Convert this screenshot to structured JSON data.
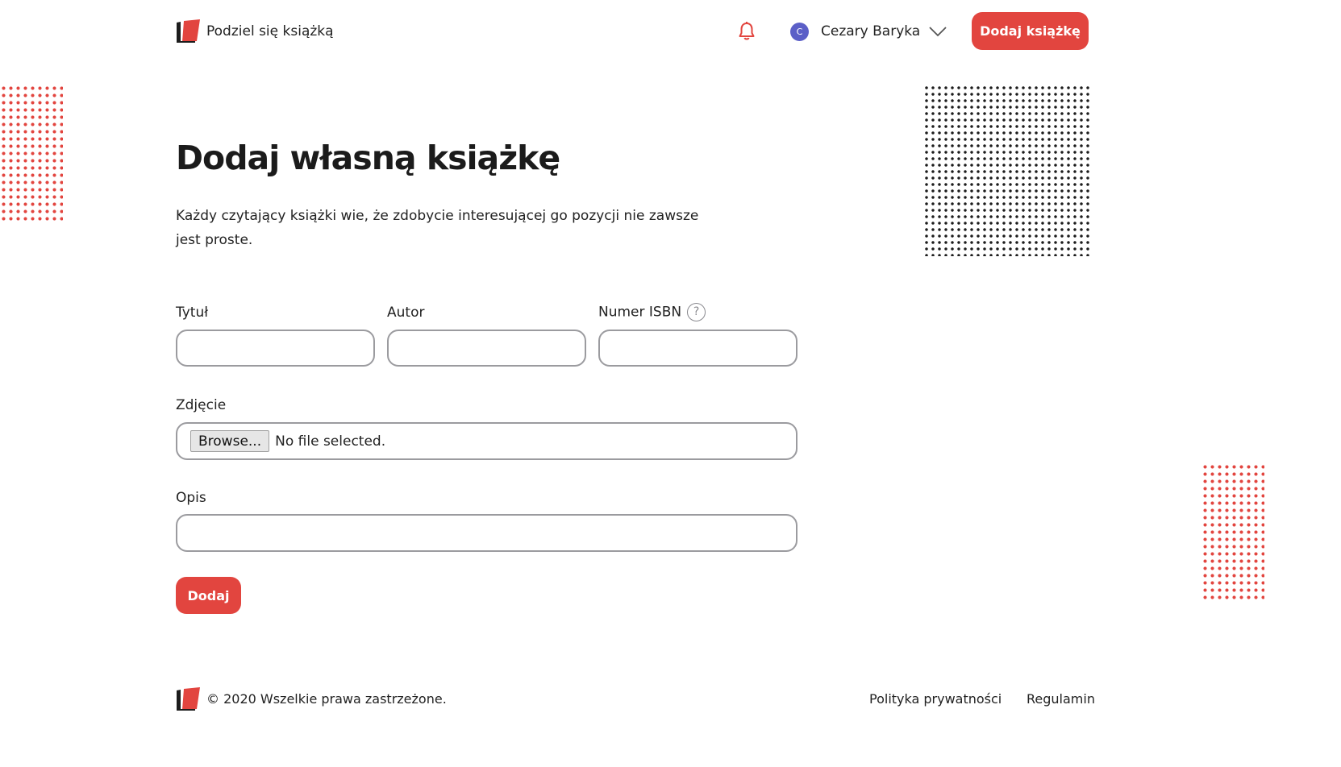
{
  "header": {
    "brand_name": "Podziel się książką",
    "logo_icon": "book-logo-icon",
    "notification_icon": "bell-icon",
    "user": {
      "initial": "C",
      "name": "Cezary Baryka"
    },
    "cta_label": "Dodaj książkę"
  },
  "main": {
    "title": "Dodaj własną książkę",
    "intro": "Każdy czytający książki wie, że zdobycie interesującej go pozycji nie zawsze jest proste."
  },
  "form": {
    "title_label": "Tytuł",
    "title_value": "",
    "author_label": "Autor",
    "author_value": "",
    "isbn_label": "Numer ISBN",
    "isbn_help": "?",
    "isbn_value": "",
    "photo_label": "Zdjęcie",
    "browse_label": "Browse...",
    "file_status": "No file selected.",
    "description_label": "Opis",
    "description_value": "",
    "submit_label": "Dodaj"
  },
  "footer": {
    "copyright": "© 2020 Wszelkie prawa zastrzeżone.",
    "links": [
      "Polityka prywatności",
      "Regulamin"
    ]
  },
  "colors": {
    "accent": "#e2453f",
    "avatar": "#5b5fc7",
    "border": "#9b9b9f",
    "text": "#1f1f1f"
  }
}
